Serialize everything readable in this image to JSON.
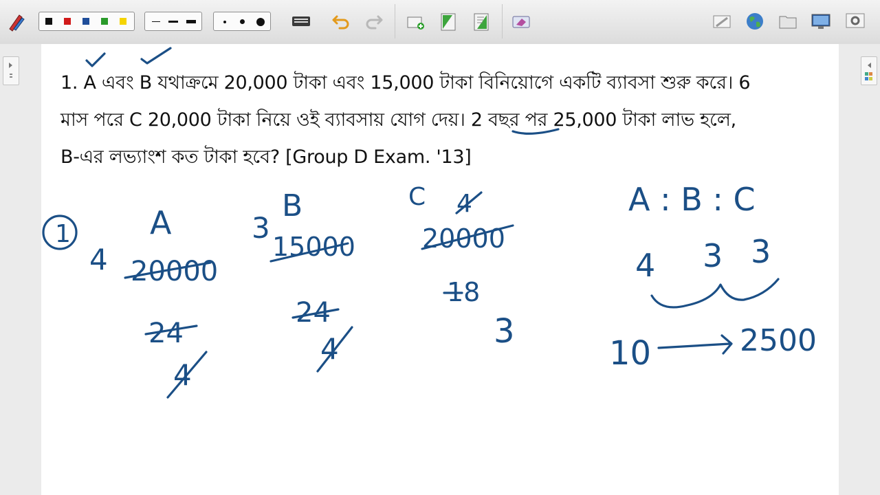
{
  "toolbar": {
    "tools": [
      {
        "name": "pen-tool-icon"
      },
      {
        "name": "color-black"
      },
      {
        "name": "color-red"
      },
      {
        "name": "color-blue"
      },
      {
        "name": "color-green"
      },
      {
        "name": "color-yellow"
      }
    ],
    "colors": [
      "#111111",
      "#d11a1a",
      "#1f4e9a",
      "#2a9a2a",
      "#f5d400"
    ]
  },
  "question": {
    "line1": "1. A এবং B যথাক্রমে 20,000 টাকা এবং 15,000 টাকা বিনিয়োগে একটি ব্যাবসা শুরু করে। 6",
    "line2": "মাস পরে C 20,000 টাকা নিয়ে ওই ব্যাবসায় যোগ দেয়। 2 বছর পর 25,000 টাকা লাভ হলে,",
    "line3": "B-এর লভ্যাংশ কত টাকা হবে? [Group D Exam. '13]"
  },
  "handwriting": {
    "circled": "1",
    "colA": {
      "head": "A",
      "factor": "4",
      "amount": "20000",
      "months": "24",
      "result": "4"
    },
    "colB": {
      "head": "B",
      "factor": "3",
      "amount": "15000",
      "months": "24",
      "result": "4"
    },
    "colC": {
      "head": "C",
      "top": "4",
      "amount": "20000",
      "months": "18",
      "result": "3"
    },
    "ratio": {
      "label": "A : B : C",
      "a": "4",
      "b": "3",
      "c": "3",
      "sum": "10",
      "arrow_to": "2500"
    }
  }
}
